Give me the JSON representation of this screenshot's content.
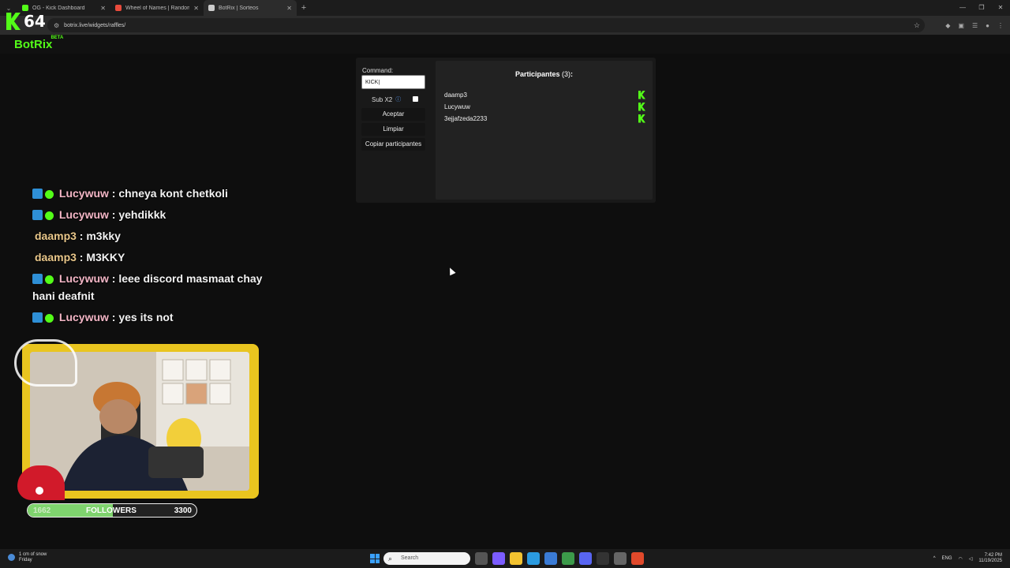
{
  "browser": {
    "tabs": [
      {
        "title": "OG - Kick Dashboard",
        "color": "#53fc18"
      },
      {
        "title": "Wheel of Names | Random name",
        "color": "#e94b3c"
      },
      {
        "title": "BotRix | Sorteos",
        "color": "#cccccc"
      }
    ],
    "url": "botrix.live/widgets/raffles/",
    "new_tab": "+"
  },
  "overlay": {
    "kick_counter": "64"
  },
  "botrix": {
    "brand": "BotRix",
    "beta": "BETA"
  },
  "raffle": {
    "command_label": "Command:",
    "command_value": "KICK|",
    "sub_label": "Sub X2",
    "sub_info": "ⓘ",
    "sub_checked": false,
    "accept_label": "Aceptar",
    "clear_label": "Limpiar",
    "copy_label": "Copiar participantes",
    "participants_title": "Participantes",
    "participants_count": "(3)",
    "participants_colon": ":",
    "participants": [
      "daamp3",
      "Lucywuw",
      "3ejjafzeda2233"
    ]
  },
  "chat": {
    "messages": [
      {
        "user": "Lucywuw",
        "text": " : chneya kont chetkoli"
      },
      {
        "user": "Lucywuw",
        "text": " : yehdikkk"
      },
      {
        "user": "daamp3",
        "text": " : m3kky"
      },
      {
        "user": "daamp3",
        "text": " : M3KKY"
      },
      {
        "user": "Lucywuw",
        "text": " : leee discord masmaat chay hani deafnit"
      },
      {
        "user": "Lucywuw",
        "text": " : yes its not"
      }
    ]
  },
  "followers": {
    "current": "1662",
    "label": "FOLLOWERS",
    "goal": "3300",
    "progress": 0.5036
  },
  "taskbar": {
    "weather_line1": "1 cm of snow",
    "weather_line2": "Friday",
    "search_placeholder": "Search",
    "lang": "ENG",
    "time": "7:42 PM",
    "date": "11/19/2025"
  }
}
